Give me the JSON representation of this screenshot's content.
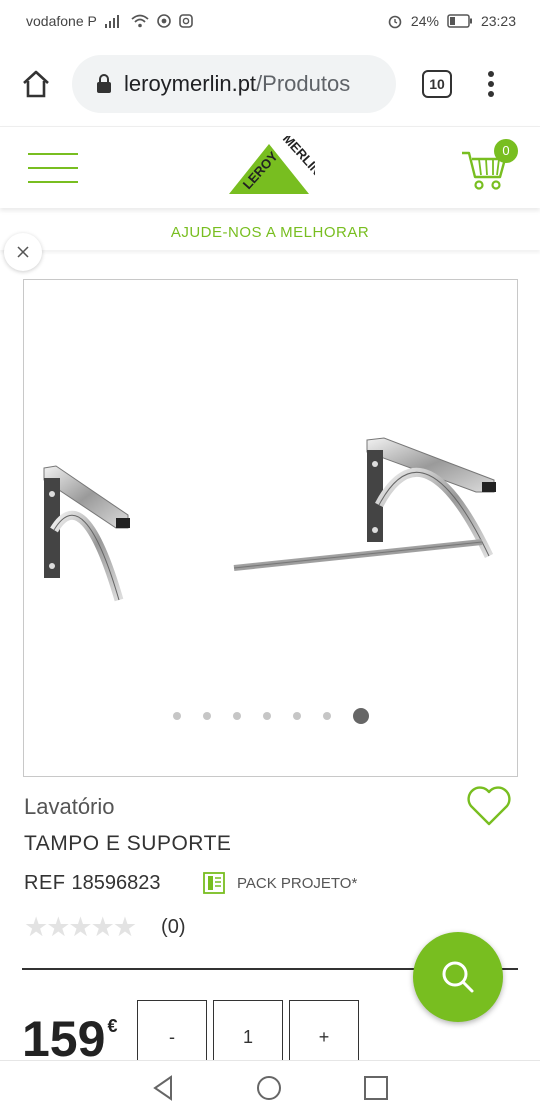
{
  "status": {
    "carrier": "vodafone P",
    "battery": "24%",
    "time": "23:23"
  },
  "browser": {
    "url_host": "leroymerlin.pt",
    "url_path": "/Produtos",
    "tab_count": "10"
  },
  "header": {
    "logo_text_1": "LEROY",
    "logo_text_2": "MERLIN",
    "cart_count": "0"
  },
  "help_bar": {
    "label": "AJUDE-NOS A MELHORAR"
  },
  "gallery": {
    "dot_count": 7,
    "active_index": 6
  },
  "product": {
    "category": "Lavatório",
    "title": "TAMPO E SUPORTE",
    "ref_label": "REF",
    "ref_value": "18596823",
    "pack_label": "PACK PROJETO*",
    "rating_stars": "★★★★★",
    "rating_count": "(0)",
    "price": "159",
    "currency": "€"
  },
  "quantity": {
    "minus": "-",
    "value": "1",
    "plus": "+"
  },
  "colors": {
    "brand_green": "#78be20"
  }
}
